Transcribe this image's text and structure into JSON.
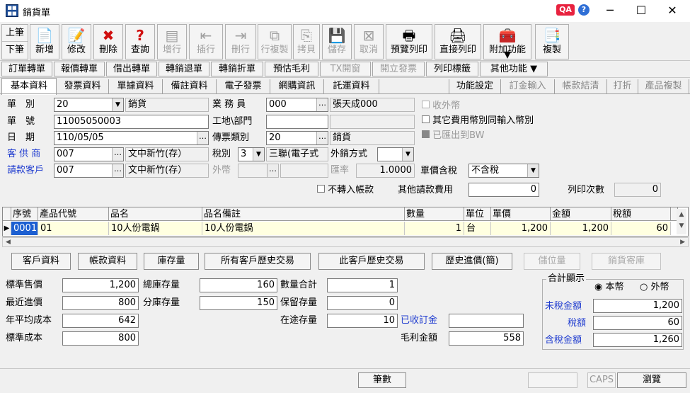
{
  "window": {
    "title": "銷貨單",
    "qa_badge": "QA",
    "help_label": "?"
  },
  "toolbar": {
    "nav_up": "上筆",
    "nav_down": "下筆",
    "buttons": [
      "新增",
      "修改",
      "刪除",
      "查詢",
      "增行",
      "插行",
      "刪行",
      "行複製",
      "拷貝",
      "儲存",
      "取消",
      "預覽列印",
      "直接列印",
      "附加功能",
      "複製"
    ]
  },
  "row2": {
    "buttons": [
      "訂單轉單",
      "報價轉單",
      "借出轉單",
      "轉銷退單",
      "轉銷折單",
      "預估毛利",
      "TX開窗",
      "開立發票",
      "列印標籤",
      "其他功能"
    ]
  },
  "tabs": {
    "left": [
      "基本資料",
      "發票資料",
      "單據資料",
      "備註資料",
      "電子發票",
      "網購資訊",
      "託運資料"
    ],
    "right": [
      "功能設定",
      "訂金輸入",
      "帳款結清",
      "打折",
      "產品複製"
    ]
  },
  "form": {
    "type_label": "單　別",
    "type_value": "20",
    "type_name": "銷貨",
    "no_label": "單　號",
    "no_value": "11005050003",
    "date_label": "日　期",
    "date_value": "110/05/05",
    "customer_label": "客 供 商",
    "customer_value": "007",
    "customer_name": "文中新竹(存）",
    "bill_label": "請款客戶",
    "bill_value": "007",
    "bill_name": "文中新竹(存）",
    "sales_label": "業 務 員",
    "sales_value": "000",
    "sales_name": "張天成000",
    "site_label": "工地\\部門",
    "voucher_label": "傳票類別",
    "voucher_value": "20",
    "voucher_name": "銷貨",
    "tax_label": "稅別",
    "tax_value": "3",
    "tax_name": "三聯(電子式",
    "export_label": "外銷方式",
    "currency_label": "外幣",
    "rate_label": "匯率",
    "rate_value": "1.0000",
    "price_tax_label": "單價含稅",
    "price_tax_value": "不含稅",
    "no_transfer_label": "不轉入帳款",
    "other_fee_label": "其他請款費用",
    "other_fee_value": "0",
    "print_count_label": "列印次數",
    "print_count_value": "0",
    "cb_foreign": "收外幣",
    "cb_other_currency": "其它費用幣別同輸入幣別",
    "cb_exported": "已匯出到BW"
  },
  "grid": {
    "headers": [
      "序號",
      "產品代號",
      "品名",
      "品名備註",
      "數量",
      "單位",
      "單價",
      "金額",
      "稅額"
    ],
    "rows": [
      [
        "0001",
        "01",
        "10人份電鍋",
        "10人份電鍋",
        "1",
        "台",
        "1,200",
        "1,200",
        "60"
      ]
    ]
  },
  "actions": [
    "客戶資料",
    "帳款資料",
    "庫存量",
    "所有客戶歷史交易",
    "此客戶歷史交易",
    "歷史進價(簡)",
    "儲位量",
    "銷貨寄庫"
  ],
  "stats": {
    "std_price_label": "標準售價",
    "std_price": "1,200",
    "recent_purchase_label": "最近進價",
    "recent_purchase": "800",
    "avg_cost_label": "年平均成本",
    "avg_cost": "642",
    "std_cost_label": "標準成本",
    "std_cost": "800",
    "total_stock_label": "總庫存量",
    "total_stock": "160",
    "branch_stock_label": "分庫存量",
    "branch_stock": "150",
    "qty_total_label": "數量合計",
    "qty_total": "1",
    "reserved_label": "保留存量",
    "reserved": "0",
    "transit_label": "在途存量",
    "transit": "10",
    "deposit_label": "已收訂金",
    "deposit": "",
    "gross_label": "毛利金額",
    "gross": "558"
  },
  "summary": {
    "title": "合計顯示",
    "opt_local": "本幣",
    "opt_foreign": "外幣",
    "pretax_label": "未稅金額",
    "pretax": "1,200",
    "tax_label": "稅額",
    "tax": "60",
    "total_label": "含稅金額",
    "total": "1,260"
  },
  "status": {
    "count_label": "筆數",
    "caps": "CAPS",
    "browse": "瀏覽"
  }
}
